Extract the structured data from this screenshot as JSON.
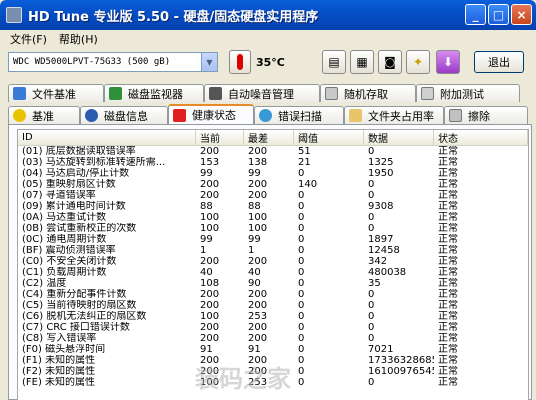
{
  "window": {
    "title": "HD Tune 专业版 5.50 - 硬盘/固态硬盘实用程序",
    "controls": {
      "minimize": "_",
      "maximize": "□",
      "close": "×"
    }
  },
  "menu": [
    "文件(F)",
    "帮助(H)"
  ],
  "toolbar": {
    "drive": "WDC WD5000LPVT-75G33 (500 gB)",
    "temperature": "35°C",
    "exit_label": "退出"
  },
  "tabs_top": [
    "文件基准",
    "磁盘监视器",
    "自动噪音管理",
    "随机存取",
    "附加测试"
  ],
  "tabs_bottom": [
    "基准",
    "磁盘信息",
    "健康状态",
    "错误扫描",
    "文件夹占用率",
    "擦除"
  ],
  "active_tab": "健康状态",
  "table": {
    "headers": [
      "ID",
      "当前",
      "最差",
      "阈值",
      "数据",
      "状态"
    ],
    "rows": [
      [
        "(01) 底层数据读取错误率",
        "200",
        "200",
        "51",
        "0",
        "正常"
      ],
      [
        "(03) 马达旋转到标准转速所需...",
        "153",
        "138",
        "21",
        "1325",
        "正常"
      ],
      [
        "(04) 马达启动/停止计数",
        "99",
        "99",
        "0",
        "1950",
        "正常"
      ],
      [
        "(05) 重映射扇区计数",
        "200",
        "200",
        "140",
        "0",
        "正常"
      ],
      [
        "(07) 寻道错误率",
        "200",
        "200",
        "0",
        "0",
        "正常"
      ],
      [
        "(09) 累计通电时间计数",
        "88",
        "88",
        "0",
        "9308",
        "正常"
      ],
      [
        "(0A) 马达重试计数",
        "100",
        "100",
        "0",
        "0",
        "正常"
      ],
      [
        "(0B) 尝试重新校正的次数",
        "100",
        "100",
        "0",
        "0",
        "正常"
      ],
      [
        "(0C) 通电周期计数",
        "99",
        "99",
        "0",
        "1897",
        "正常"
      ],
      [
        "(BF) 震动侦测错误率",
        "1",
        "1",
        "0",
        "12458",
        "正常"
      ],
      [
        "(C0) 不安全关闭计数",
        "200",
        "200",
        "0",
        "342",
        "正常"
      ],
      [
        "(C1) 负载周期计数",
        "40",
        "40",
        "0",
        "480038",
        "正常"
      ],
      [
        "(C2) 温度",
        "108",
        "90",
        "0",
        "35",
        "正常"
      ],
      [
        "(C4) 重新分配事件计数",
        "200",
        "200",
        "0",
        "0",
        "正常"
      ],
      [
        "(C5) 当前待映射的扇区数",
        "200",
        "200",
        "0",
        "0",
        "正常"
      ],
      [
        "(C6) 脱机无法纠正的扇区数",
        "100",
        "253",
        "0",
        "0",
        "正常"
      ],
      [
        "(C7) CRC 接口错误计数",
        "200",
        "200",
        "0",
        "0",
        "正常"
      ],
      [
        "(C8) 写入错误率",
        "200",
        "200",
        "0",
        "0",
        "正常"
      ],
      [
        "(F0) 磁头悬浮时间",
        "91",
        "91",
        "0",
        "7021",
        "正常"
      ],
      [
        "(F1) 未知的属性",
        "200",
        "200",
        "0",
        "17336328685",
        "正常"
      ],
      [
        "(F2) 未知的属性",
        "200",
        "200",
        "0",
        "16100976545",
        "正常"
      ],
      [
        "(FE) 未知的属性",
        "100",
        "253",
        "0",
        "0",
        "正常"
      ]
    ]
  },
  "watermark": "装码之家",
  "icons": {
    "thermometer": "thermometer-icon",
    "copy_text": "copy-text-icon",
    "copy_info": "copy-info-icon",
    "screenshot": "camera-icon",
    "options": "options-icon",
    "save": "save-icon"
  },
  "colors": {
    "title_bar": "#0550c8",
    "active_tab_accent": "#e68b2c",
    "window_bg": "#ece9d8"
  }
}
